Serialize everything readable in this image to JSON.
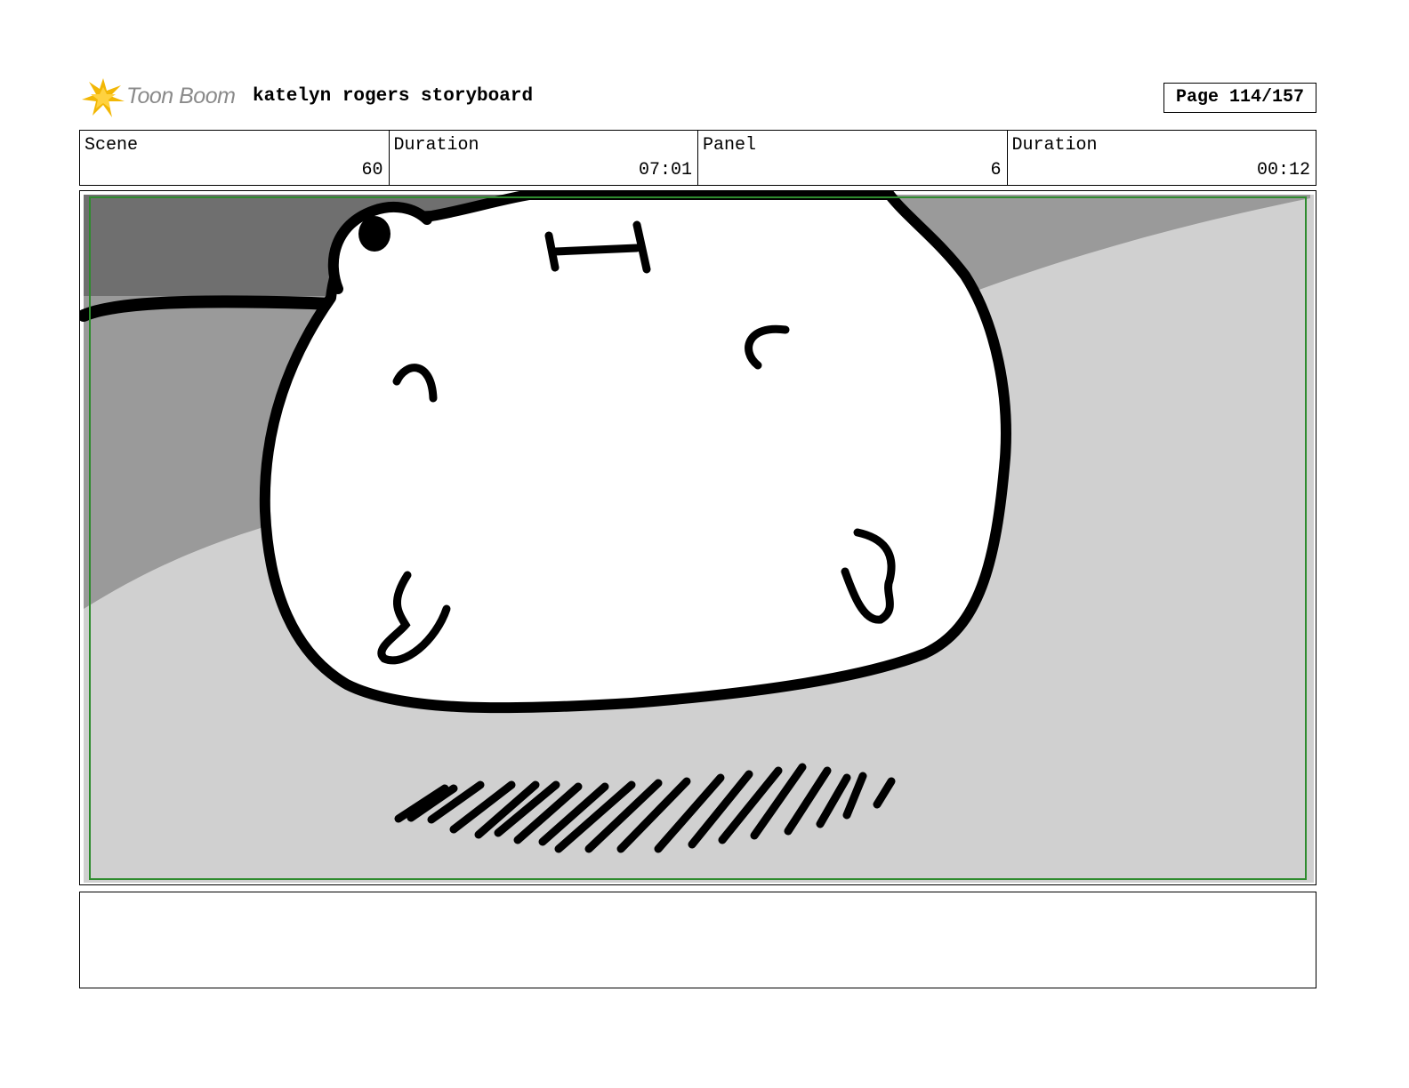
{
  "header": {
    "logo_text": "Toon Boom",
    "title": "katelyn rogers storyboard",
    "page_label": "Page 114/157"
  },
  "info": {
    "scene_label": "Scene",
    "scene_value": "60",
    "scene_duration_label": "Duration",
    "scene_duration_value": "07:01",
    "panel_label": "Panel",
    "panel_value": "6",
    "panel_duration_label": "Duration",
    "panel_duration_value": "00:12"
  },
  "notes": {
    "text": ""
  },
  "colors": {
    "logo_star": "#f2b705",
    "safe_frame": "#2e8b2e",
    "bg_dark": "#6f6f6f",
    "bg_mid": "#9a9a9a",
    "bg_light": "#d0d0d0"
  }
}
